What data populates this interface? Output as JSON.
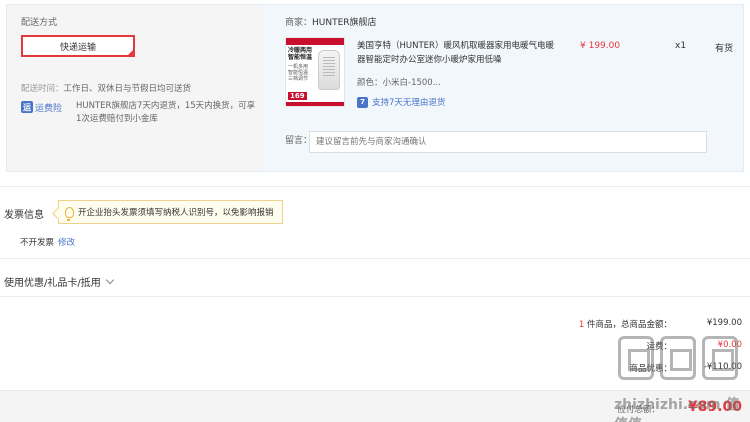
{
  "shipping": {
    "section_label": "配送方式",
    "method_button": "快递运输",
    "time_label": "配送时间：",
    "time_value": "工作日、双休日与节假日均可送货",
    "freight_icon": "运",
    "freight_label": "运费险",
    "freight_text": "HUNTER旗舰店7天内退货，15天内换货，可享1次运费赔付到小金库"
  },
  "shop": {
    "label": "商家：",
    "name": "HUNTER旗舰店"
  },
  "product": {
    "image_badge": "冷暖两用 智能恒温",
    "image_features": "一机多用 智能恒温 三档调节",
    "image_price": "169",
    "title": "美国亨特（HUNTER）暖风机取暖器家用电暖气电暖器智能定时办公室迷你小暖炉家用低噪",
    "color_label": "颜色：",
    "color_value": "小米白-1500...",
    "return_icon": "7",
    "return_text": "支持7天无理由退货",
    "price": "¥ 199.00",
    "qty": "x1",
    "stock": "有货"
  },
  "remark": {
    "label": "留言：",
    "placeholder": "建议留言前先与商家沟通确认"
  },
  "invoice": {
    "title": "发票信息",
    "tip": "开企业抬头发票须填写纳税人识别号，以免影响报销",
    "status": "不开发票",
    "edit": "修改"
  },
  "coupon": {
    "label": "使用优惠/礼品卡/抵用"
  },
  "summary": {
    "count": "1",
    "count_suffix": " 件商品，总商品金额：",
    "goods_amount": "¥199.00",
    "row2_label": "运费：",
    "row2_amount": "¥0.00",
    "row3_label": "商品优惠：",
    "row3_amount": "-¥110.00",
    "total_label": "应付总额：",
    "total_amount": "¥89.00"
  },
  "watermark": {
    "text": "zhizhizhi.com 值值值"
  },
  "colors": {
    "accent_red": "#e4393c",
    "link_blue": "#4a74c9"
  }
}
